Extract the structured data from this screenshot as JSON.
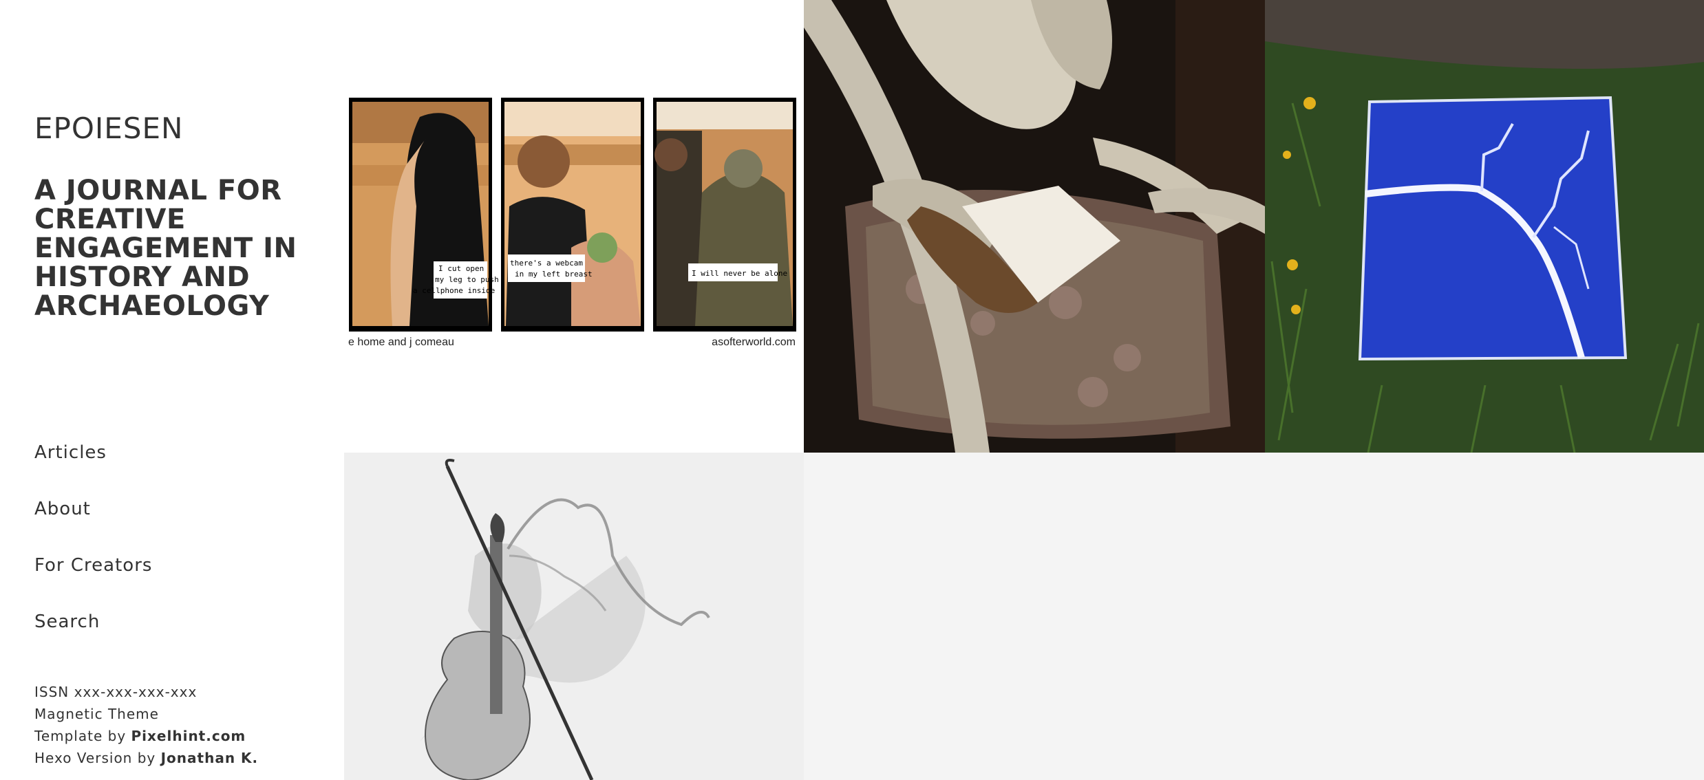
{
  "site": {
    "title": "EPOIESEN",
    "subtitle": "A JOURNAL FOR CREATIVE ENGAGEMENT IN HISTORY AND ARCHAEOLOGY"
  },
  "nav": {
    "items": [
      {
        "label": "Articles"
      },
      {
        "label": "About"
      },
      {
        "label": "For Creators"
      },
      {
        "label": "Search"
      }
    ]
  },
  "footer": {
    "issn": "ISSN xxx-xxx-xxx-xxx",
    "theme": "Magnetic Theme",
    "template_prefix": "Template by ",
    "template_author": "Pixelhint.com",
    "hexo_prefix": "Hexo Version by ",
    "hexo_author": "Jonathan K."
  },
  "tiles": {
    "comic": {
      "caption1": [
        "I cut open",
        "my leg to push",
        "a cellphone inside"
      ],
      "caption2": [
        "there's a webcam",
        "in my left breast"
      ],
      "caption3": "I will never be alone",
      "credit_left": "e home and j comeau",
      "credit_right": "asofterworld.com"
    }
  },
  "colors": {
    "sidebar_bg": "#ffffff",
    "page_bg": "#f4f4f4",
    "text": "#333333",
    "blue_canvas": "#2440c8"
  }
}
